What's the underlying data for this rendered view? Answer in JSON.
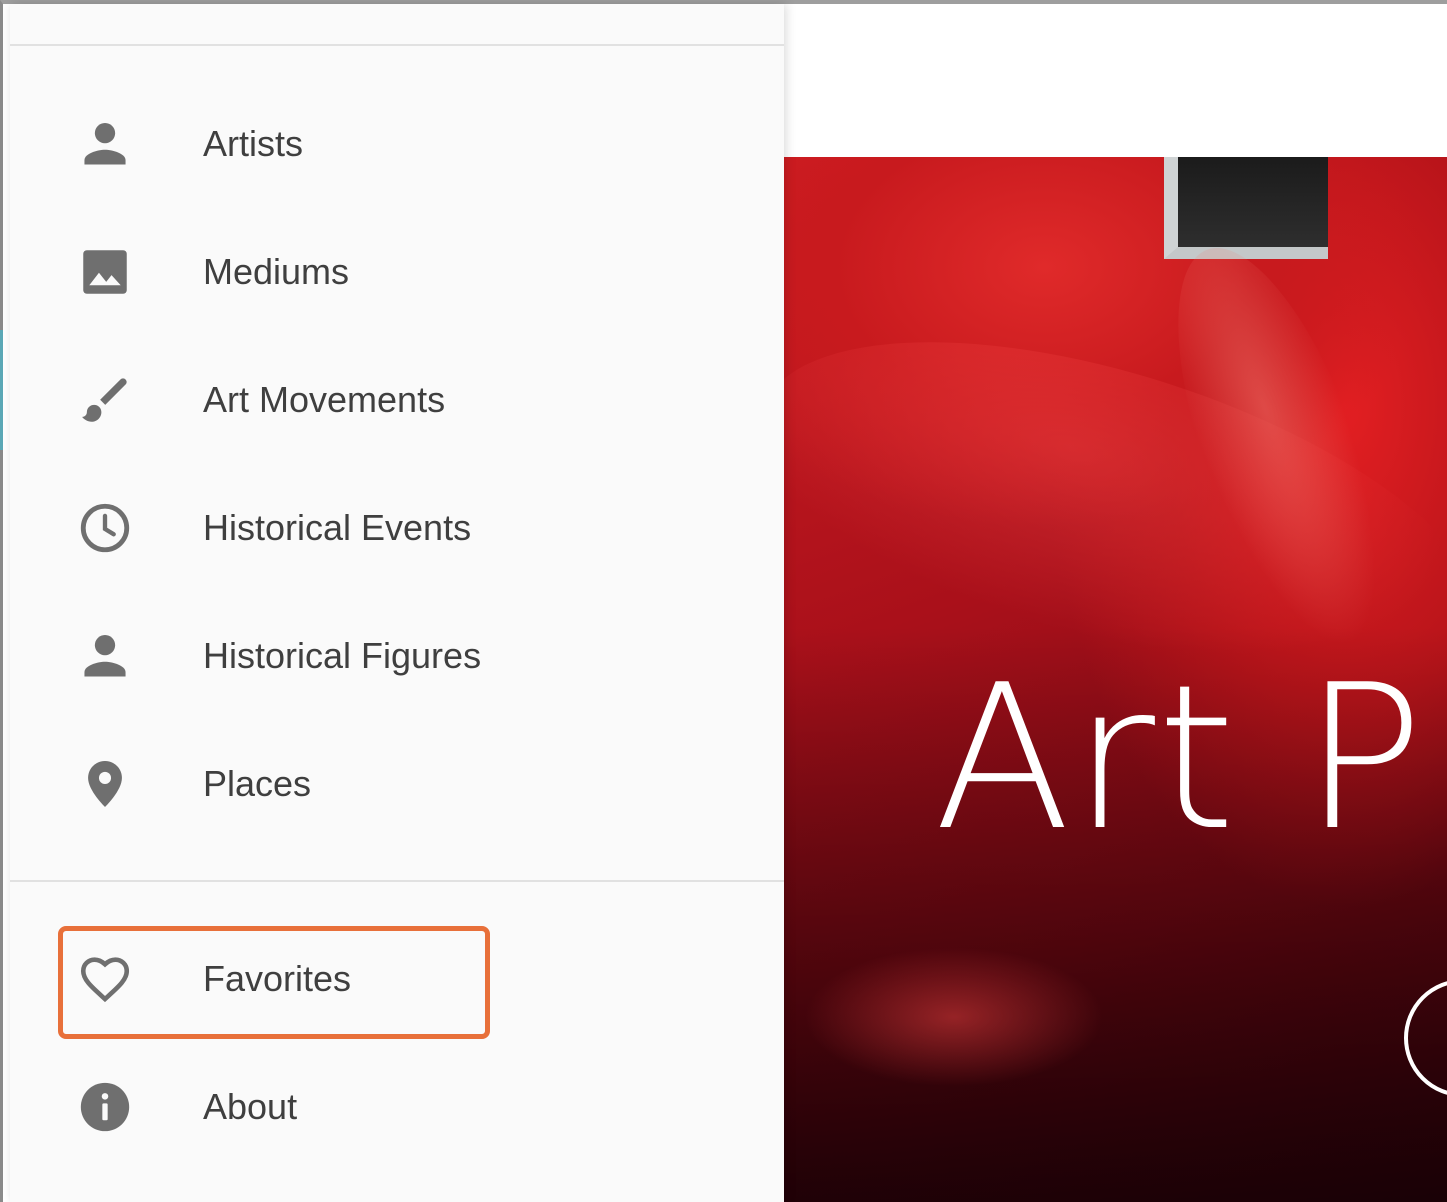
{
  "drawer": {
    "primary_items": [
      {
        "label": "Artists",
        "icon": "person-icon"
      },
      {
        "label": "Mediums",
        "icon": "image-icon"
      },
      {
        "label": "Art Movements",
        "icon": "brush-icon"
      },
      {
        "label": "Historical Events",
        "icon": "clock-icon"
      },
      {
        "label": "Historical Figures",
        "icon": "person-icon"
      },
      {
        "label": "Places",
        "icon": "place-icon"
      }
    ],
    "secondary_items": [
      {
        "label": "Favorites",
        "icon": "heart-outline-icon",
        "highlighted": true
      },
      {
        "label": "About",
        "icon": "info-icon"
      }
    ]
  },
  "hero": {
    "title": "Art P"
  },
  "colors": {
    "drawer_background": "#fafafa",
    "icon_color": "#6f6f6f",
    "label_color": "#3f3f3f",
    "highlight_border": "#e8703a",
    "hero_red": "#c81a1e"
  }
}
